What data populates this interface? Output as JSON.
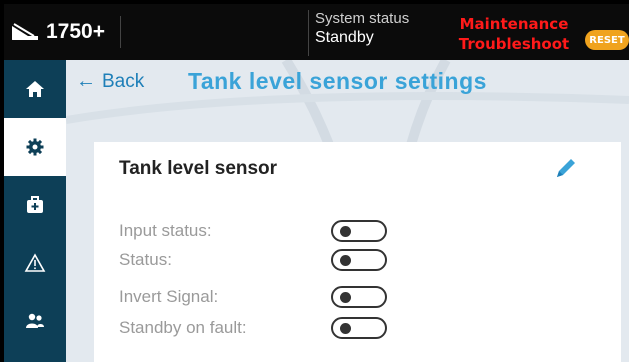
{
  "header": {
    "model": "1750+",
    "status_label": "System status",
    "status_value": "Standby",
    "alert_line1": "Maintenance",
    "alert_line2": "Troubleshoot",
    "reset_label": "RESET"
  },
  "sidebar": {
    "items": [
      {
        "icon": "home-icon",
        "active": false
      },
      {
        "icon": "gear-icon",
        "active": true
      },
      {
        "icon": "first-aid-kit-icon",
        "active": false
      },
      {
        "icon": "warning-icon",
        "active": false
      },
      {
        "icon": "users-icon",
        "active": false
      }
    ]
  },
  "page": {
    "back_label": "Back",
    "title": "Tank level sensor settings"
  },
  "card": {
    "title": "Tank level sensor",
    "rows": [
      {
        "label": "Input status:",
        "toggle": "off"
      },
      {
        "label": "Status:",
        "toggle": "off"
      },
      {
        "label": "Invert Signal:",
        "toggle": "off"
      },
      {
        "label": "Standby on fault:",
        "toggle": "off"
      }
    ]
  },
  "colors": {
    "sidebar": "#0d3f57",
    "accent": "#3aa3d8",
    "alert": "#ff1a1a",
    "reset": "#f0a31e"
  }
}
